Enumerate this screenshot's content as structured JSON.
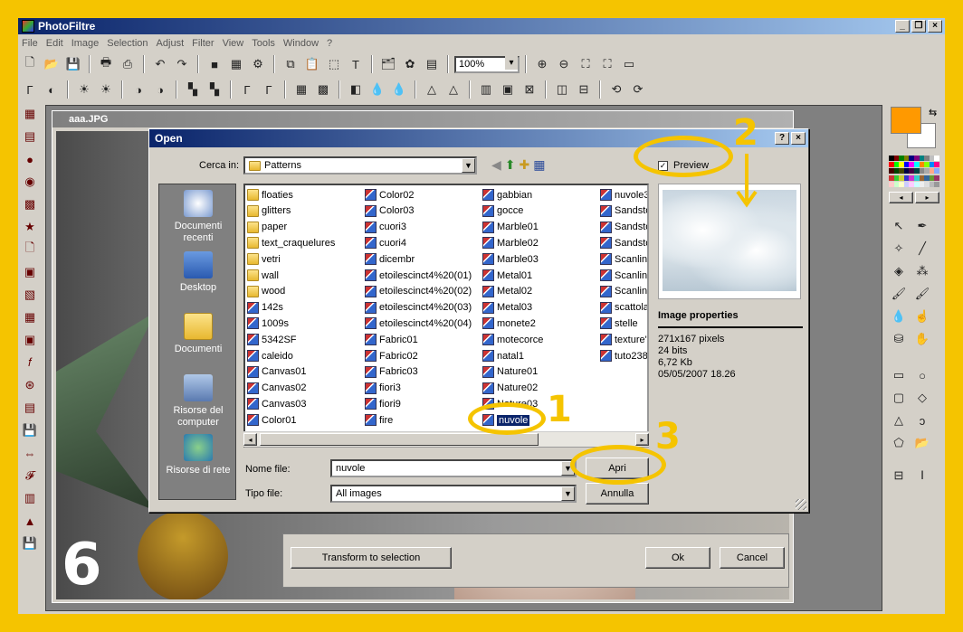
{
  "app": {
    "title": "PhotoFiltre"
  },
  "menu": [
    "File",
    "Edit",
    "Image",
    "Selection",
    "Adjust",
    "Filter",
    "View",
    "Tools",
    "Window",
    "?"
  ],
  "toolbar": {
    "zoom": "100%"
  },
  "image_window": {
    "title": "aaa.JPG"
  },
  "under_dialog": {
    "transform": "Transform to selection",
    "ok": "Ok",
    "cancel": "Cancel"
  },
  "dialog": {
    "title": "Open",
    "look_in_label": "Cerca in:",
    "look_in_value": "Patterns",
    "preview_label": "Preview",
    "filename_label": "Nome file:",
    "filename_value": "nuvole",
    "filetype_label": "Tipo file:",
    "filetype_value": "All images",
    "open_button": "Apri",
    "cancel_button": "Annulla",
    "places": [
      "Documenti recenti",
      "Desktop",
      "Documenti",
      "Risorse del computer",
      "Risorse di rete"
    ],
    "columns": [
      [
        {
          "n": "floaties",
          "t": "folder"
        },
        {
          "n": "glitters",
          "t": "folder"
        },
        {
          "n": "paper",
          "t": "folder"
        },
        {
          "n": "text_craquelures",
          "t": "folder"
        },
        {
          "n": "vetri",
          "t": "folder"
        },
        {
          "n": "wall",
          "t": "folder"
        },
        {
          "n": "wood",
          "t": "folder"
        },
        {
          "n": "142s",
          "t": "img"
        },
        {
          "n": "1009s",
          "t": "img"
        },
        {
          "n": "5342SF",
          "t": "img"
        },
        {
          "n": "caleido",
          "t": "img"
        },
        {
          "n": "Canvas01",
          "t": "img"
        },
        {
          "n": "Canvas02",
          "t": "img"
        },
        {
          "n": "Canvas03",
          "t": "img"
        },
        {
          "n": "Color01",
          "t": "img"
        }
      ],
      [
        {
          "n": "Color02",
          "t": "img"
        },
        {
          "n": "Color03",
          "t": "img"
        },
        {
          "n": "cuori3",
          "t": "img"
        },
        {
          "n": "cuori4",
          "t": "img"
        },
        {
          "n": "dicembr",
          "t": "img"
        },
        {
          "n": "etoilescinct4%20(01)",
          "t": "img"
        },
        {
          "n": "etoilescinct4%20(02)",
          "t": "img"
        },
        {
          "n": "etoilescinct4%20(03)",
          "t": "img"
        },
        {
          "n": "etoilescinct4%20(04)",
          "t": "img"
        },
        {
          "n": "Fabric01",
          "t": "img"
        },
        {
          "n": "Fabric02",
          "t": "img"
        },
        {
          "n": "Fabric03",
          "t": "img"
        },
        {
          "n": "fiori3",
          "t": "img"
        },
        {
          "n": "fiori9",
          "t": "img"
        },
        {
          "n": "fire",
          "t": "img"
        }
      ],
      [
        {
          "n": "gabbian",
          "t": "img"
        },
        {
          "n": "gocce",
          "t": "img"
        },
        {
          "n": "Marble01",
          "t": "img"
        },
        {
          "n": "Marble02",
          "t": "img"
        },
        {
          "n": "Marble03",
          "t": "img"
        },
        {
          "n": "Metal01",
          "t": "img"
        },
        {
          "n": "Metal02",
          "t": "img"
        },
        {
          "n": "Metal03",
          "t": "img"
        },
        {
          "n": "monete2",
          "t": "img"
        },
        {
          "n": "motecorce",
          "t": "img"
        },
        {
          "n": "natal1",
          "t": "img"
        },
        {
          "n": "Nature01",
          "t": "img"
        },
        {
          "n": "Nature02",
          "t": "img"
        },
        {
          "n": "Nature03",
          "t": "img"
        },
        {
          "n": "nuvole",
          "t": "img",
          "sel": true
        }
      ],
      [
        {
          "n": "nuvole3",
          "t": "img"
        },
        {
          "n": "Sandsto",
          "t": "img"
        },
        {
          "n": "Sandsto",
          "t": "img"
        },
        {
          "n": "Sandsto",
          "t": "img"
        },
        {
          "n": "Scanline",
          "t": "img"
        },
        {
          "n": "Scanline",
          "t": "img"
        },
        {
          "n": "Scanline",
          "t": "img"
        },
        {
          "n": "scattola",
          "t": "img"
        },
        {
          "n": "stelle",
          "t": "img"
        },
        {
          "n": "texture'",
          "t": "img"
        },
        {
          "n": "tuto238",
          "t": "img"
        }
      ]
    ],
    "props_title": "Image properties",
    "props": [
      "271x167 pixels",
      "24 bits",
      "6,72 Kb",
      "05/05/2007 18.26"
    ]
  },
  "annotations": {
    "n1": "1",
    "n2": "2",
    "n3": "3",
    "step": "6"
  },
  "colors": {
    "accent": "#f5c400",
    "selection": "#0a246a",
    "foreground": "#ff9900",
    "background": "#ffffff"
  }
}
